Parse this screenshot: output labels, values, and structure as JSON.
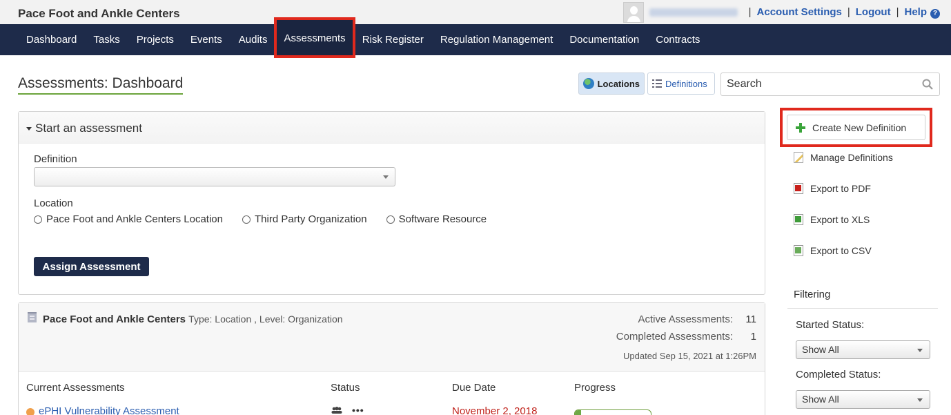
{
  "app": {
    "org_name": "Pace Foot and Ankle Centers"
  },
  "top_links": {
    "account_settings": "Account Settings",
    "logout": "Logout",
    "help": "Help",
    "separator": "|"
  },
  "nav": {
    "items": [
      "Dashboard",
      "Tasks",
      "Projects",
      "Events",
      "Audits",
      "Assessments",
      "Risk Register",
      "Regulation Management",
      "Documentation",
      "Contracts"
    ],
    "active": "Assessments"
  },
  "page": {
    "title": "Assessments: Dashboard",
    "view_locations": "Locations",
    "view_definitions": "Definitions",
    "search_value": "Search"
  },
  "start_panel": {
    "title": "Start an assessment",
    "definition_label": "Definition",
    "location_label": "Location",
    "location_options": [
      "Pace Foot and Ankle Centers Location",
      "Third Party Organization",
      "Software Resource"
    ],
    "assign_button": "Assign Assessment"
  },
  "location_card": {
    "name": "Pace Foot and Ankle Centers",
    "meta": "Type: Location , Level: Organization",
    "active_label": "Active Assessments:",
    "active_count": "11",
    "completed_label": "Completed Assessments:",
    "completed_count": "1",
    "updated": "Updated Sep 15, 2021 at 1:26PM",
    "columns": [
      "Current Assessments",
      "Status",
      "Due Date",
      "Progress"
    ],
    "rows": [
      {
        "name": "ePHI Vulnerability Assessment",
        "due_date": "November 2, 2018",
        "progress": 0.08,
        "status_color": "#f0a04b"
      }
    ]
  },
  "sidebar": {
    "create_new_definition": "Create New Definition",
    "manage_definitions": "Manage Definitions",
    "export_pdf": "Export to PDF",
    "export_xls": "Export to XLS",
    "export_csv": "Export to CSV",
    "filtering_title": "Filtering",
    "started_status_label": "Started Status:",
    "started_status_value": "Show All",
    "completed_status_label": "Completed Status:",
    "completed_status_value": "Show All"
  },
  "colors": {
    "nav_bg": "#1e2b4a",
    "highlight": "#e0291d",
    "link": "#2a5db0",
    "due_date": "#c0221b"
  }
}
